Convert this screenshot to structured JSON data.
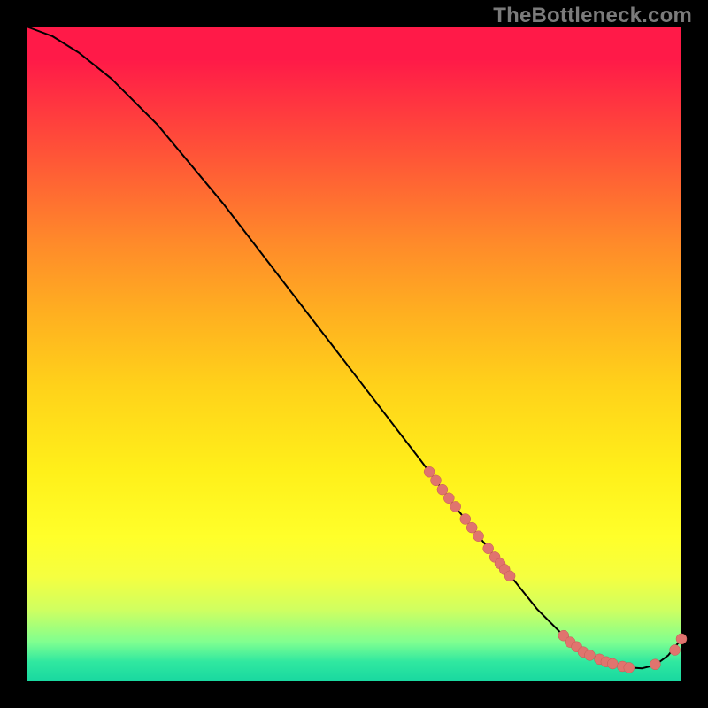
{
  "watermark": "TheBottleneck.com",
  "colors": {
    "background": "#000000",
    "watermark_text": "#7b7b7b",
    "curve_stroke": "#000000",
    "marker_fill": "#e0746e",
    "marker_stroke": "#c45a54"
  },
  "chart_data": {
    "type": "line",
    "title": "",
    "xlabel": "",
    "ylabel": "",
    "xlim": [
      0,
      100
    ],
    "ylim": [
      0,
      100
    ],
    "curve": {
      "x": [
        0,
        4,
        8,
        13,
        20,
        30,
        40,
        50,
        60,
        66,
        70,
        74,
        78,
        82,
        85,
        88,
        91,
        94,
        96,
        98,
        100
      ],
      "y": [
        100,
        98.5,
        96,
        92,
        85,
        73,
        60,
        47,
        34,
        26,
        21,
        16,
        11,
        7,
        4.5,
        3,
        2.2,
        2,
        2.5,
        4,
        6.5
      ]
    },
    "series": [
      {
        "name": "markers-upper-slope",
        "x": [
          61.5,
          62.5,
          63.5,
          64.5,
          65.5,
          67.0,
          68.0,
          69.0,
          70.5
        ],
        "y": [
          32.0,
          30.7,
          29.3,
          28.0,
          26.7,
          24.8,
          23.5,
          22.2,
          20.3
        ]
      },
      {
        "name": "markers-mid-slope",
        "x": [
          71.5,
          72.3,
          73.0,
          73.8
        ],
        "y": [
          19.0,
          18.0,
          17.1,
          16.1
        ]
      },
      {
        "name": "markers-trough",
        "x": [
          82.0,
          83.0,
          84.0,
          85.0,
          86.0,
          87.5,
          88.5,
          89.5,
          91.0,
          92.0
        ],
        "y": [
          7.0,
          6.0,
          5.3,
          4.5,
          4.0,
          3.4,
          3.0,
          2.7,
          2.3,
          2.1
        ]
      },
      {
        "name": "markers-tail",
        "x": [
          96.0,
          99.0,
          100.0
        ],
        "y": [
          2.6,
          4.8,
          6.5
        ]
      }
    ]
  }
}
